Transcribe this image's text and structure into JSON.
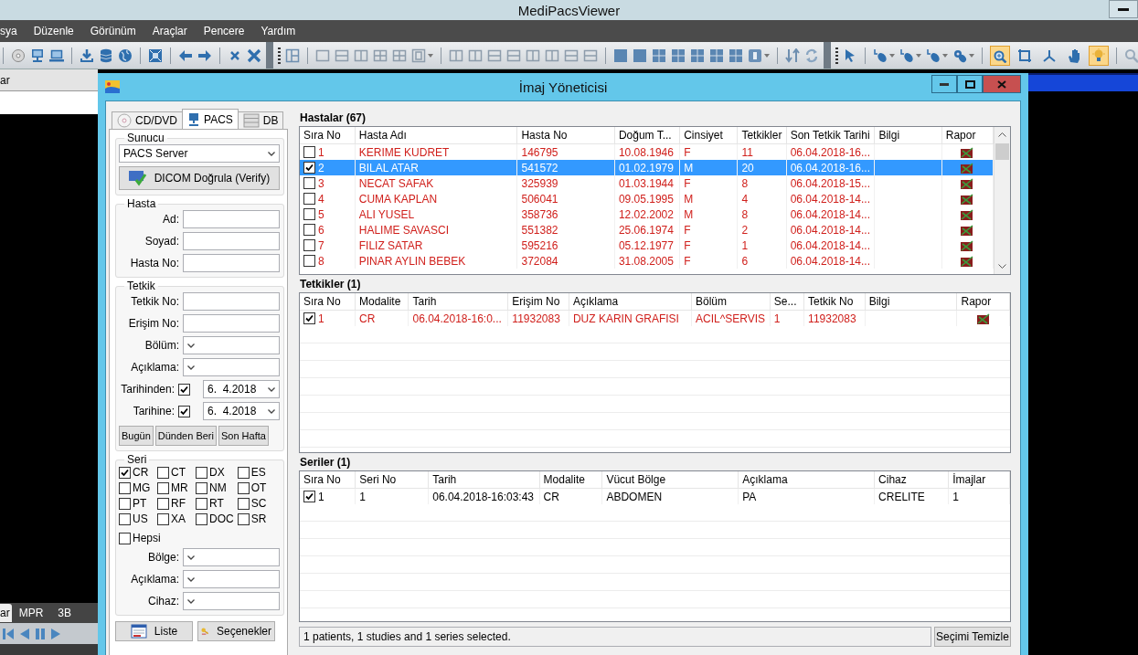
{
  "app": {
    "title": "MediPacsViewer",
    "menu": [
      "sya",
      "Düzenle",
      "Görünüm",
      "Araçlar",
      "Pencere",
      "Yardım"
    ],
    "toolbar_toggles": [
      {
        "selected": true
      },
      {
        "selected": false
      },
      {
        "selected": false
      },
      {
        "selected": false
      },
      {
        "selected": true
      }
    ],
    "panel_tab": "ar",
    "view_tabs": [
      {
        "label": "ar",
        "selected": true
      },
      {
        "label": "MPR",
        "selected": false
      },
      {
        "label": "3B",
        "selected": false
      }
    ]
  },
  "dialog": {
    "title": "İmaj Yöneticisi",
    "source_tabs": [
      {
        "label": "CD/DVD",
        "selected": false
      },
      {
        "label": "PACS",
        "selected": true
      },
      {
        "label": "DB",
        "selected": false
      }
    ],
    "server": {
      "legend": "Sunucu",
      "value": "PACS Server",
      "verify_button": "DICOM Doğrula (Verify)"
    },
    "patient": {
      "legend": "Hasta",
      "fields": [
        {
          "label": "Ad:",
          "kind": "text"
        },
        {
          "label": "Soyad:",
          "kind": "text"
        },
        {
          "label": "Hasta No:",
          "kind": "text"
        }
      ]
    },
    "study": {
      "legend": "Tetkik",
      "fields": [
        {
          "label": "Tetkik No:",
          "kind": "text"
        },
        {
          "label": "Erişim No:",
          "kind": "text"
        },
        {
          "label": "Bölüm:",
          "kind": "select"
        },
        {
          "label": "Açıklama:",
          "kind": "select"
        },
        {
          "label": "Tarihinden:",
          "kind": "date",
          "checked": true,
          "value": "6.  4.2018"
        },
        {
          "label": "Tarihine:",
          "kind": "date",
          "checked": true,
          "value": "6.  4.2018"
        }
      ],
      "quick_buttons": [
        "Bugün",
        "Dünden Beri",
        "Son Hafta"
      ]
    },
    "series_filter": {
      "legend": "Seri",
      "modalities": [
        {
          "label": "CR",
          "checked": true
        },
        {
          "label": "CT",
          "checked": false
        },
        {
          "label": "DX",
          "checked": false
        },
        {
          "label": "ES",
          "checked": false
        },
        {
          "label": "MG",
          "checked": false
        },
        {
          "label": "MR",
          "checked": false
        },
        {
          "label": "NM",
          "checked": false
        },
        {
          "label": "OT",
          "checked": false
        },
        {
          "label": "PT",
          "checked": false
        },
        {
          "label": "RF",
          "checked": false
        },
        {
          "label": "RT",
          "checked": false
        },
        {
          "label": "SC",
          "checked": false
        },
        {
          "label": "US",
          "checked": false
        },
        {
          "label": "XA",
          "checked": false
        },
        {
          "label": "DOC",
          "checked": false
        },
        {
          "label": "SR",
          "checked": false
        }
      ],
      "all": {
        "label": "Hepsi",
        "checked": false
      },
      "fields": [
        {
          "label": "Bölge:",
          "kind": "select"
        },
        {
          "label": "Açıklama:",
          "kind": "select"
        },
        {
          "label": "Cihaz:",
          "kind": "select"
        }
      ]
    },
    "actions": [
      {
        "label": "Liste",
        "kind": "list"
      },
      {
        "label": "Seçenekler",
        "kind": "key"
      }
    ],
    "patients": {
      "title": "Hastalar (67)",
      "columns": [
        "Sıra No",
        "Hasta Adı",
        "Hasta No",
        "Doğum T...",
        "Cinsiyet",
        "Tetkikler",
        "Son Tetkik Tarihi",
        "Bilgi",
        "Rapor"
      ],
      "rows": [
        {
          "checked": false,
          "selected": false,
          "report": true,
          "cells": [
            "1",
            "KERIME KUDRET",
            "146795",
            "10.08.1946",
            "F",
            "11",
            "06.04.2018-16..."
          ]
        },
        {
          "checked": true,
          "selected": true,
          "report": true,
          "cells": [
            "2",
            "BILAL ATAR",
            "541572",
            "01.02.1979",
            "M",
            "20",
            "06.04.2018-16..."
          ]
        },
        {
          "checked": false,
          "selected": false,
          "report": true,
          "cells": [
            "3",
            "NECAT SAFAK",
            "325939",
            "01.03.1944",
            "F",
            "8",
            "06.04.2018-15..."
          ]
        },
        {
          "checked": false,
          "selected": false,
          "report": true,
          "cells": [
            "4",
            "CUMA KAPLAN",
            "506041",
            "09.05.1995",
            "M",
            "4",
            "06.04.2018-14..."
          ]
        },
        {
          "checked": false,
          "selected": false,
          "report": true,
          "cells": [
            "5",
            "ALI YUSEL",
            "358736",
            "12.02.2002",
            "M",
            "8",
            "06.04.2018-14..."
          ]
        },
        {
          "checked": false,
          "selected": false,
          "report": true,
          "cells": [
            "6",
            "HALIME SAVASCI",
            "551382",
            "25.06.1974",
            "F",
            "2",
            "06.04.2018-14..."
          ]
        },
        {
          "checked": false,
          "selected": false,
          "report": true,
          "cells": [
            "7",
            "FILIZ SATAR",
            "595216",
            "05.12.1977",
            "F",
            "1",
            "06.04.2018-14..."
          ]
        },
        {
          "checked": false,
          "selected": false,
          "report": true,
          "cells": [
            "8",
            "PINAR AYLIN BEBEK",
            "372084",
            "31.08.2005",
            "F",
            "6",
            "06.04.2018-14..."
          ]
        }
      ]
    },
    "studies": {
      "title": "Tetkikler (1)",
      "columns": [
        "Sıra No",
        "Modalite",
        "Tarih",
        "Erişim No",
        "Açıklama",
        "Bölüm",
        "Se...",
        "Tetkik No",
        "Bilgi",
        "Rapor"
      ],
      "rows": [
        {
          "checked": true,
          "selected": false,
          "report": true,
          "cells": [
            "1",
            "CR",
            "06.04.2018-16:0...",
            "11932083",
            "DUZ KARIN GRAFISI",
            "ACIL^SERVIS",
            "1",
            "11932083"
          ]
        }
      ]
    },
    "series": {
      "title": "Seriler (1)",
      "columns": [
        "Sıra No",
        "Seri No",
        "Tarih",
        "Modalite",
        "Vücut Bölge",
        "Açıklama",
        "Cihaz",
        "İmajlar"
      ],
      "rows": [
        {
          "checked": true,
          "selected": false,
          "report": false,
          "cells": [
            "1",
            "1",
            "06.04.2018-16:03:43",
            "CR",
            "ABDOMEN",
            "PA",
            "CRELITE",
            "1"
          ]
        }
      ]
    },
    "status": "1 patients, 1 studies and 1 series selected.",
    "clear_button": "Seçimi Temizle"
  }
}
